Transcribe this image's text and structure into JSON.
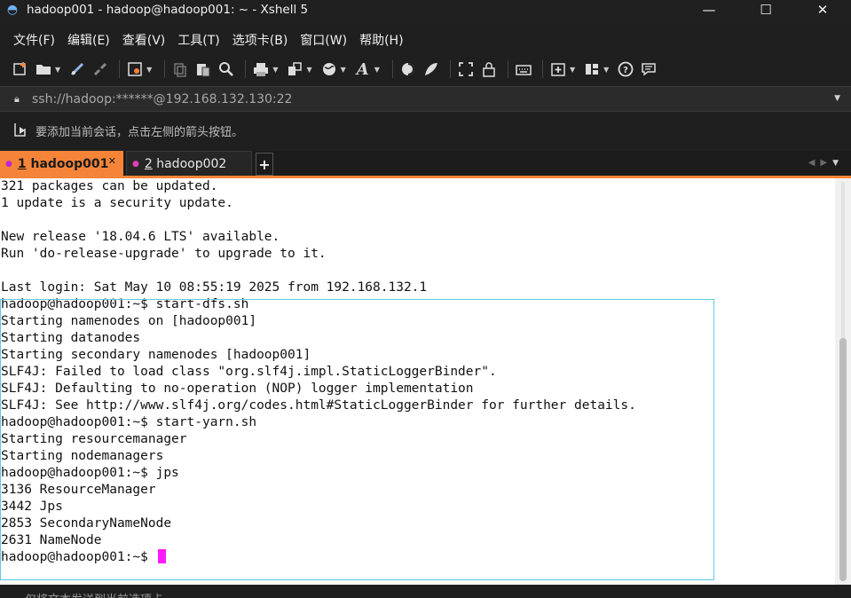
{
  "window": {
    "title": "hadoop001 - hadoop@hadoop001: ~ - Xshell 5",
    "controls": {
      "minimize": "—",
      "maximize": "☐",
      "close": "✕"
    }
  },
  "menu": {
    "items": [
      "文件(F)",
      "编辑(E)",
      "查看(V)",
      "工具(T)",
      "选项卡(B)",
      "窗口(W)",
      "帮助(H)"
    ]
  },
  "toolbar": {
    "icons": [
      "new-session-icon",
      "open-folder-icon",
      "connect-icon",
      "disconnect-icon",
      "properties-icon",
      "copy-icon",
      "paste-icon",
      "find-icon",
      "print-icon",
      "transfer-icon",
      "globe-icon",
      "font-icon",
      "xftp-icon",
      "xmanager-icon",
      "fullscreen-icon",
      "lock-icon",
      "keyboard-icon",
      "new-tab-icon",
      "layout-icon",
      "help-icon",
      "chat-icon"
    ]
  },
  "address": {
    "value": "ssh://hadoop:******@192.168.132.130:22"
  },
  "hint": {
    "text": "要添加当前会话，点击左侧的箭头按钮。"
  },
  "tabs": [
    {
      "number": "1",
      "label": "hadoop001",
      "active": true,
      "dot_color": "#c026d3"
    },
    {
      "number": "2",
      "label": "hadoop002",
      "active": false,
      "dot_color": "#e33fb8"
    }
  ],
  "tab_add_label": "+",
  "terminal": {
    "lines": [
      "321 packages can be updated.",
      "1 update is a security update.",
      "",
      "New release '18.04.6 LTS' available.",
      "Run 'do-release-upgrade' to upgrade to it.",
      "",
      "Last login: Sat May 10 08:55:19 2025 from 192.168.132.1",
      "hadoop@hadoop001:~$ start-dfs.sh",
      "Starting namenodes on [hadoop001]",
      "Starting datanodes",
      "Starting secondary namenodes [hadoop001]",
      "SLF4J: Failed to load class \"org.slf4j.impl.StaticLoggerBinder\".",
      "SLF4J: Defaulting to no-operation (NOP) logger implementation",
      "SLF4J: See http://www.slf4j.org/codes.html#StaticLoggerBinder for further details.",
      "hadoop@hadoop001:~$ start-yarn.sh",
      "Starting resourcemanager",
      "Starting nodemanagers",
      "hadoop@hadoop001:~$ jps",
      "3136 ResourceManager",
      "3442 Jps",
      "2853 SecondaryNameNode",
      "2631 NameNode"
    ],
    "prompt": "hadoop@hadoop001:~$ ",
    "cursor_color": "#ff1aff",
    "background": "#ffffff"
  },
  "status": {
    "text": "仅将文本发送到当前选项卡"
  },
  "colors": {
    "accent": "#f58439",
    "highlight_border": "#5fc9e0",
    "chrome_bg": "#1f1f1f"
  }
}
